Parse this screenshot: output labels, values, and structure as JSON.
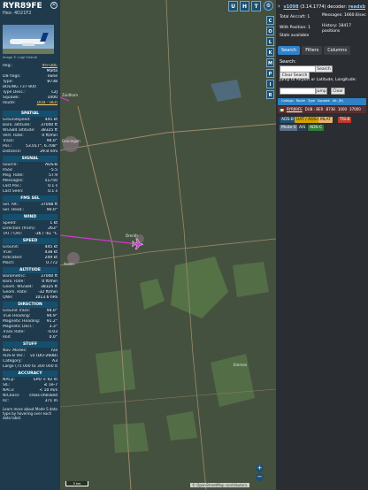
{
  "aircraft": {
    "callsign": "RYR89FE",
    "hex_label": "Hex: 4D21F2",
    "photo_credit": "Image © Luigi Orlandi",
    "close_symbol": "✕",
    "details": [
      {
        "k": "Reg.:",
        "v": "9H-QBE",
        "link": true
      },
      {
        "k": "",
        "v": "Malta"
      },
      {
        "k": "DB flags:",
        "v": "none"
      },
      {
        "k": "Type:",
        "v": "B738"
      },
      {
        "k": "BOEING 737-800",
        "v": ""
      },
      {
        "k": "Type Desc.:",
        "v": "L2J"
      },
      {
        "k": "Squawk:",
        "v": "1000"
      },
      {
        "k": "Route:",
        "v": "DUB - BER",
        "link": true
      }
    ]
  },
  "sections": [
    {
      "title": "SPATIAL",
      "rows": [
        {
          "k": "Groundspeed:",
          "v": "445 kt"
        },
        {
          "k": "Baro. altitude:",
          "v": "37000 ft"
        },
        {
          "k": "WGS84 altitude:",
          "v": "38325 ft"
        },
        {
          "k": "Vert. Rate:",
          "v": "0 ft/min"
        },
        {
          "k": "Track:",
          "v": "94.0°"
        },
        {
          "k": "Pos.:",
          "v": "53.017°, 6.708°"
        },
        {
          "k": "Distance:",
          "v": "29.8 nmi"
        }
      ]
    },
    {
      "title": "SIGNAL",
      "rows": [
        {
          "k": "Source:",
          "v": "ADS-B"
        },
        {
          "k": "RSSI:",
          "v": "-5.5"
        },
        {
          "k": "Msg. Rate:",
          "v": "57.9"
        },
        {
          "k": "Messages:",
          "v": "51750"
        },
        {
          "k": "Last Pos.:",
          "v": "0.1 s"
        },
        {
          "k": "Last Seen:",
          "v": "0.1 s"
        }
      ]
    },
    {
      "title": "FMS SEL",
      "rows": [
        {
          "k": "Sel. Alt.:",
          "v": "37008 ft"
        },
        {
          "k": "Sel. Head.:",
          "v": "90.0°"
        }
      ]
    },
    {
      "title": "WIND",
      "rows": [
        {
          "k": "Speed:",
          "v": "1 kt"
        },
        {
          "k": "Direction (from):",
          "v": "263°"
        },
        {
          "k": "TAT / OAT:",
          "v": "-36 / -61 °C"
        }
      ]
    },
    {
      "title": "SPEED",
      "rows": [
        {
          "k": "Ground:",
          "v": "445 kt"
        },
        {
          "k": "True:",
          "v": "438 kt"
        },
        {
          "k": "Indicated:",
          "v": "249 kt"
        },
        {
          "k": "Mach:",
          "v": "0.772"
        }
      ]
    },
    {
      "title": "ALTITUDE",
      "rows": [
        {
          "k": "Barometric:",
          "v": "37000 ft"
        },
        {
          "k": "Baro. Rate:",
          "v": "0 ft/min"
        },
        {
          "k": "Geom. WGS84:",
          "v": "38325 ft"
        },
        {
          "k": "Geom. Rate:",
          "v": "-32 ft/min"
        },
        {
          "k": "QNH:",
          "v": "1013.6 hPa"
        }
      ]
    },
    {
      "title": "DIRECTION",
      "rows": [
        {
          "k": "Ground Track:",
          "v": "94.0°"
        },
        {
          "k": "True Heading:",
          "v": "94.9°"
        },
        {
          "k": "Magnetic Heading:",
          "v": "91.2°"
        },
        {
          "k": "Magnetic Decl.:",
          "v": "3.3°"
        },
        {
          "k": "Track Rate:",
          "v": "-0.03"
        },
        {
          "k": "Roll:",
          "v": "0.0°"
        }
      ]
    },
    {
      "title": "STUFF",
      "rows": [
        {
          "k": "Nav. Modes:",
          "v": "n/a"
        },
        {
          "k": "ADS-B Ver.:",
          "v": "v2 (DO-260B)"
        },
        {
          "k": "Category:",
          "v": "A3"
        },
        {
          "k": "Large (75 000 to 300 000 lb)",
          "v": ""
        }
      ]
    },
    {
      "title": "ACCURACY",
      "rows": [
        {
          "k": "NACp:",
          "v": "EPU < 92 m"
        },
        {
          "k": "SIL:",
          "v": "≤ 1e-7"
        },
        {
          "k": "NACv:",
          "v": "< 10 m/s"
        },
        {
          "k": "NICbaro:",
          "v": "cross-checked"
        },
        {
          "k": "Rc:",
          "v": "371 m"
        }
      ]
    }
  ],
  "footer_note": "Learn more about Mode S data type by hovering over each data label.",
  "map": {
    "top_buttons": [
      "U",
      "H",
      "T"
    ],
    "side_buttons": [
      "C",
      "O",
      "L",
      "K",
      "M",
      "P",
      "I",
      "R"
    ],
    "zoom_in": "+",
    "zoom_out": "−",
    "cities": [
      "Groningen",
      "Drenth",
      "Assen",
      "Emmen",
      "Zuidhorn"
    ],
    "scale_label": "5 km",
    "attribution": "© OpenStreetMap contributors."
  },
  "right": {
    "chevron": "›",
    "version_label": "v1098",
    "version_text": "(3.14.1774) decoder:",
    "decoder_link": "readsb",
    "stats": [
      {
        "k": "Total Aircraft: 1",
        "v": "Messages: 1660.6/sec"
      },
      {
        "k": "With Position: 1",
        "v": "History: 18417 positions"
      },
      {
        "k": "Stats available",
        "v": ""
      }
    ],
    "tabs": [
      "Search",
      "Filters",
      "Columns"
    ],
    "search_label": "Search:",
    "search_button": "Search",
    "clear_search": "Clear Search",
    "jump_label": "Jump to Airport or Latitude, Longitude:",
    "jump_button": "Jump",
    "clear_button": "Clear",
    "table_headers": [
      "Callsign",
      "Route",
      "Type",
      "Squawk",
      "Alt. (ft)"
    ],
    "table_row": [
      "RYR89FE",
      "DUB - BER",
      "B738",
      "1000",
      "37000"
    ],
    "sources": [
      {
        "label": "ADS-B",
        "color": "#1d4f6f"
      },
      {
        "label": "UAT / ADS-R",
        "color": "#d1a200"
      },
      {
        "label": "MLAT",
        "color": "#e8b26a"
      },
      {
        "label": "TIS-B",
        "color": "#c0392b"
      },
      {
        "label": "Mode-S",
        "color": "#5b6f88"
      },
      {
        "label": "AIS",
        "color": "#2b3c4e"
      },
      {
        "label": "ADS-C",
        "color": "#2f7d38"
      }
    ]
  }
}
